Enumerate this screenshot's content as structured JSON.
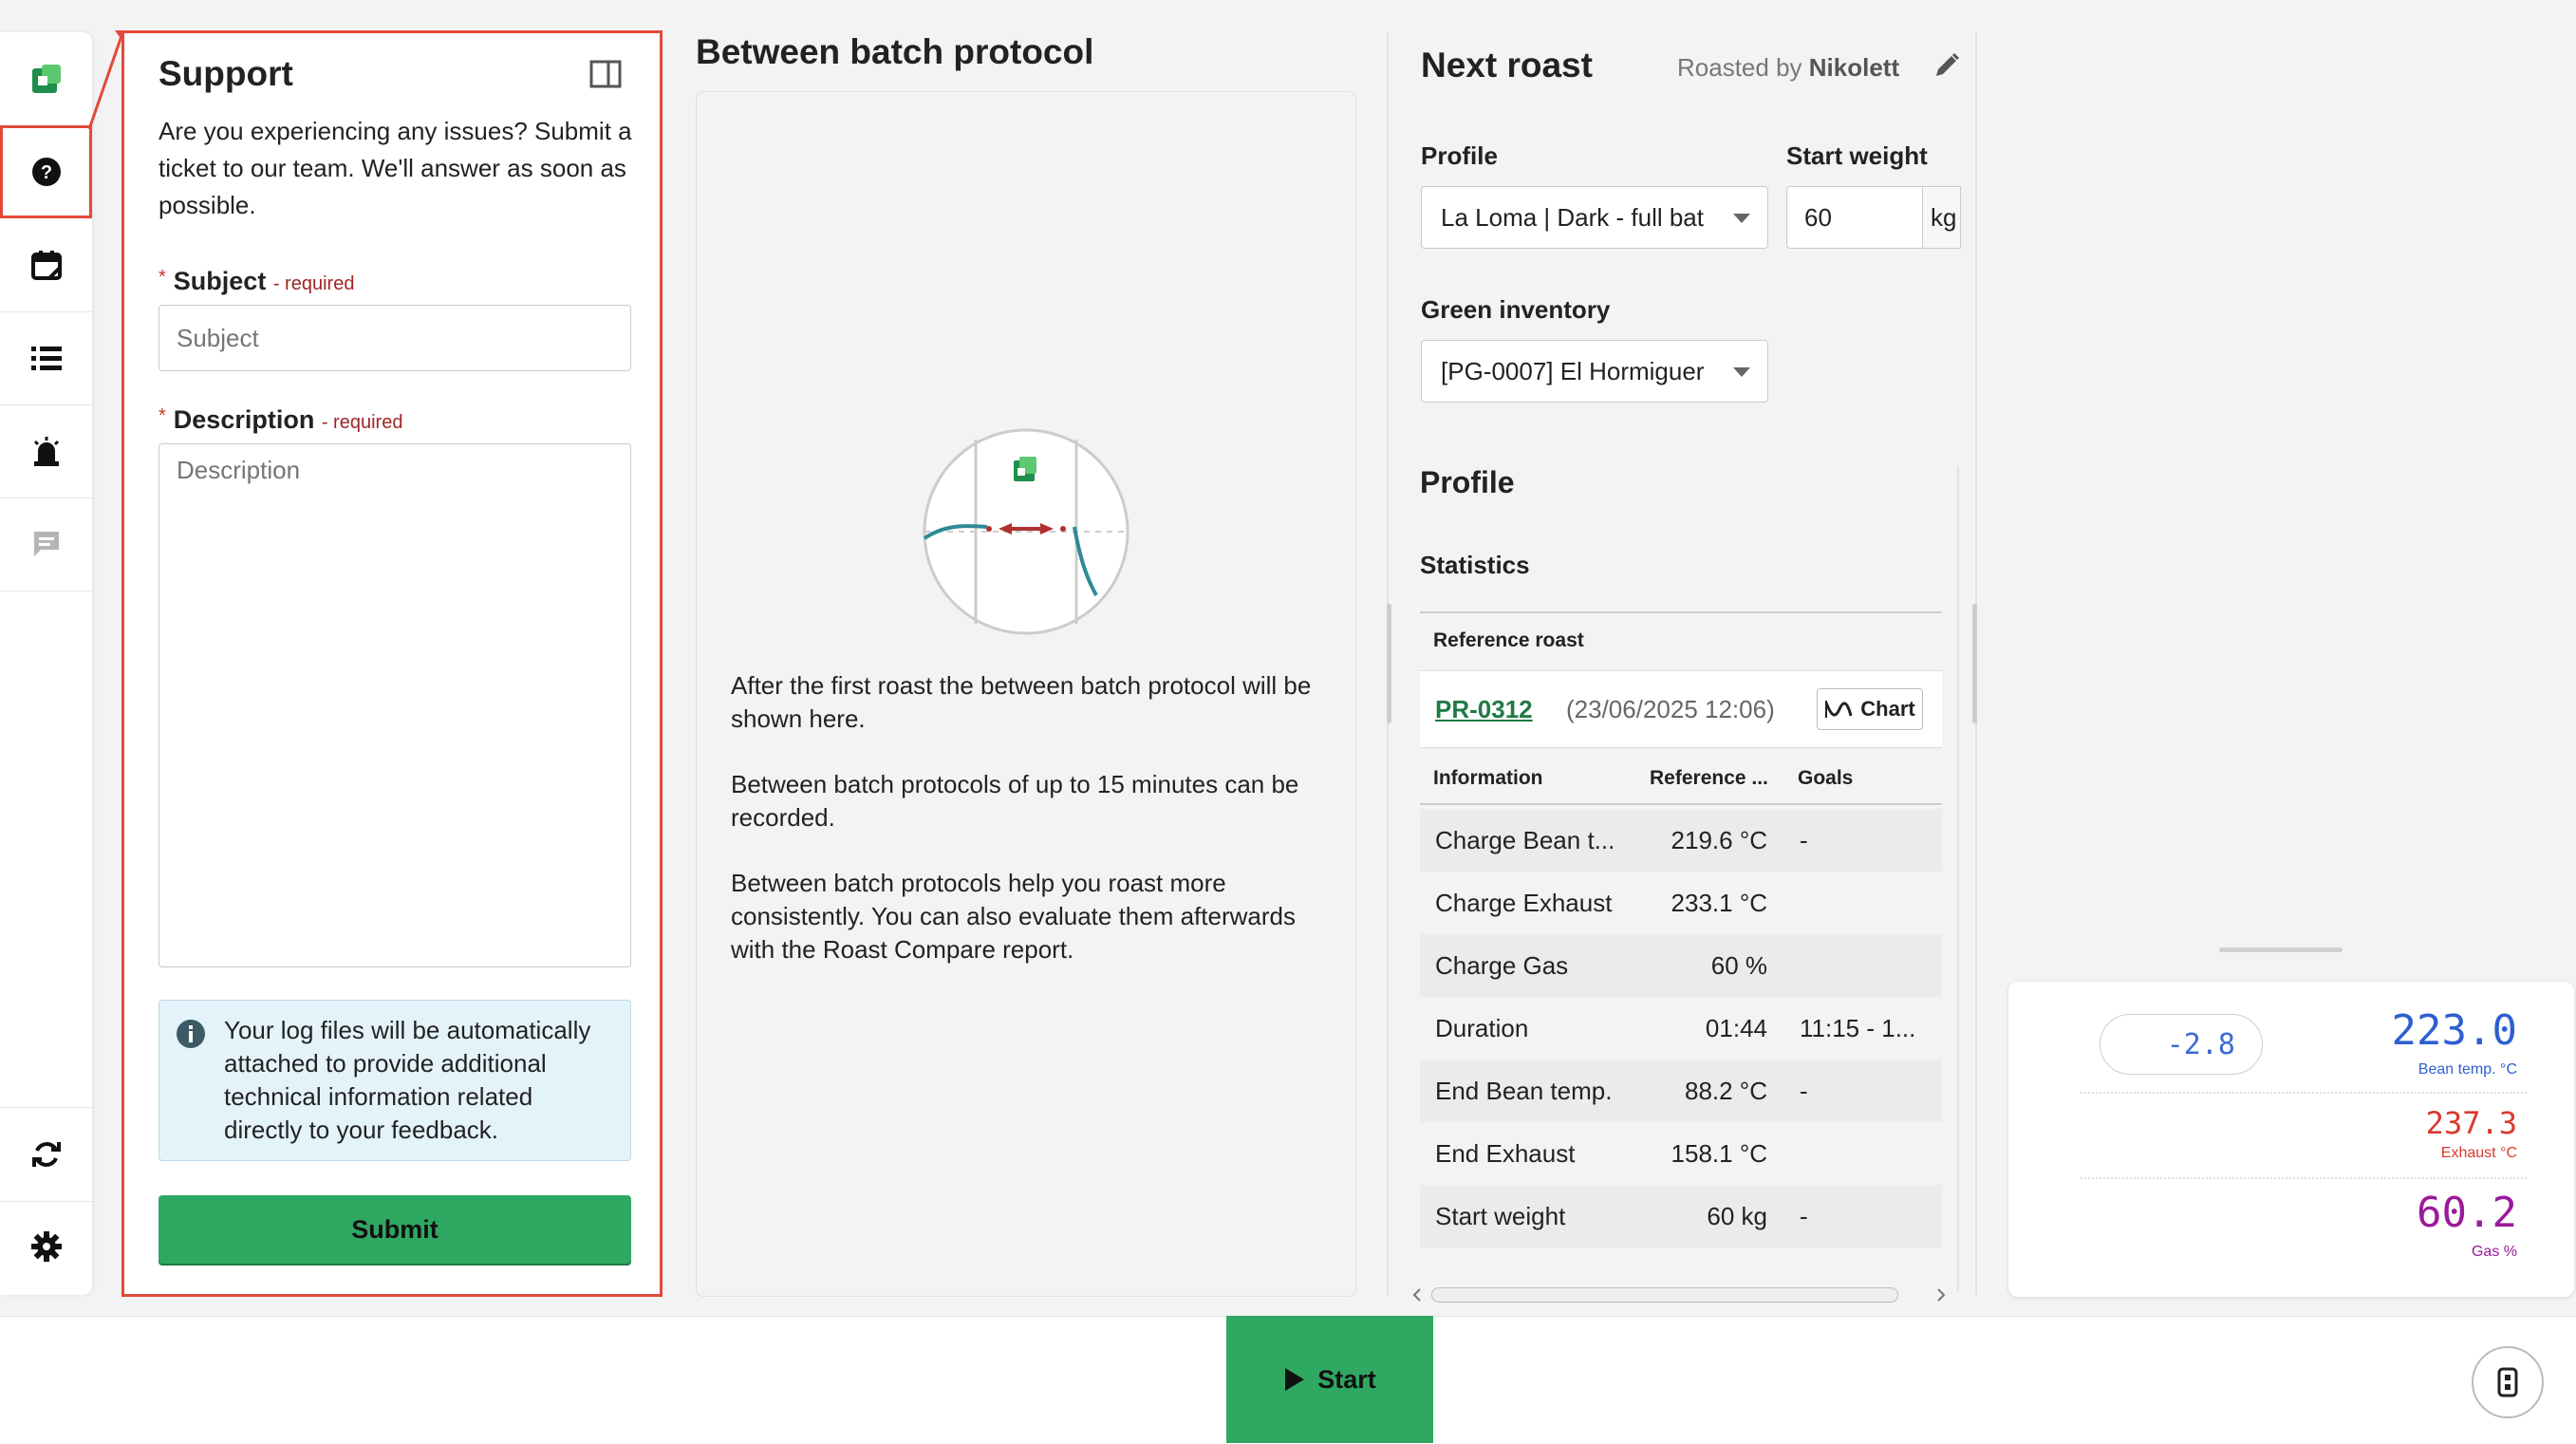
{
  "sidebar": {
    "items": [
      {
        "icon": "logo-icon"
      },
      {
        "icon": "help-icon",
        "highlighted": true
      },
      {
        "icon": "calendar-icon"
      },
      {
        "icon": "list-icon"
      },
      {
        "icon": "alarm-icon"
      },
      {
        "icon": "chat-icon"
      },
      {
        "icon": "sync-icon"
      },
      {
        "icon": "gear-icon"
      }
    ]
  },
  "support": {
    "title": "Support",
    "intro": "Are you experiencing any issues? Submit a ticket to our team. We'll answer as soon as possible.",
    "subject_label": "Subject",
    "subject_required": "- required",
    "subject_placeholder": "Subject",
    "description_label": "Description",
    "description_required": "- required",
    "description_placeholder": "Description",
    "info_text": "Your log files will be automatically attached to provide additional technical information related directly to your feedback.",
    "submit_label": "Submit"
  },
  "between_batch": {
    "title": "Between batch protocol",
    "paragraphs": [
      "After the first roast the between batch protocol will be shown here.",
      "Between batch protocols of up to 15 minutes can be recorded.",
      "Between batch protocols help you roast more consistently. You can also evaluate them afterwards with the Roast Compare report."
    ]
  },
  "next_roast": {
    "title": "Next roast",
    "roasted_by_prefix": "Roasted by",
    "roaster": "Nikolett",
    "profile_label": "Profile",
    "profile_value": "La Loma | Dark - full bat",
    "start_weight_label": "Start weight",
    "start_weight_value": "60",
    "start_weight_unit": "kg",
    "green_inventory_label": "Green inventory",
    "green_inventory_value": "[PG-0007] El Hormiguer",
    "profile_section": "Profile",
    "statistics": "Statistics",
    "reference_roast_header": "Reference roast",
    "reference_id": "PR-0312",
    "reference_date": "(23/06/2025 12:06)",
    "chart_button": "Chart",
    "table": {
      "headers": [
        "Information",
        "Reference ...",
        "Goals"
      ],
      "rows": [
        [
          "Charge Bean t...",
          "219.6 °C",
          "-"
        ],
        [
          "Charge Exhaust",
          "233.1 °C",
          ""
        ],
        [
          "Charge Gas",
          "60 %",
          ""
        ],
        [
          "Duration",
          "01:44",
          "11:15 - 1..."
        ],
        [
          "End Bean temp.",
          "88.2 °C",
          "-"
        ],
        [
          "End Exhaust",
          "158.1 °C",
          ""
        ],
        [
          "Start weight",
          "60 kg",
          "-"
        ]
      ]
    }
  },
  "readings": {
    "ror": "-2.8",
    "bean_temp": "223.0",
    "bean_temp_label": "Bean temp. °C",
    "exhaust": "237.3",
    "exhaust_label": "Exhaust °C",
    "gas": "60.2",
    "gas_label": "Gas %",
    "colors": {
      "bean": "#2e5fd0",
      "exhaust": "#d83a2e",
      "gas": "#9b1a9b"
    }
  },
  "bottom": {
    "start_label": "Start"
  },
  "colors": {
    "accent": "#2fa862",
    "highlight": "#e3493a",
    "link": "#1f7a45"
  }
}
